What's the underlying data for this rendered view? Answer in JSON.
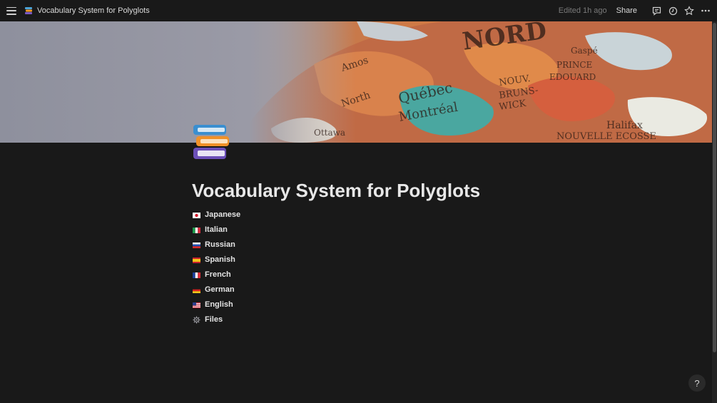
{
  "topbar": {
    "menu_icon": "hamburger-icon",
    "breadcrumb_emoji": "books-emoji",
    "breadcrumb_title": "Vocabulary System for Polyglots",
    "edited": "Edited 1h ago",
    "share_label": "Share",
    "icons": [
      "comment-icon",
      "clock-icon",
      "star-icon",
      "more-icon"
    ]
  },
  "cover": {
    "description_icon": "world-map-globe-image"
  },
  "page": {
    "icon": "books-emoji",
    "title": "Vocabulary System for Polyglots",
    "items": [
      {
        "label": "Japanese",
        "icon": "japan-flag-icon"
      },
      {
        "label": "Italian",
        "icon": "italy-flag-icon"
      },
      {
        "label": "Russian",
        "icon": "russia-flag-icon"
      },
      {
        "label": "Spanish",
        "icon": "spain-flag-icon"
      },
      {
        "label": "French",
        "icon": "france-flag-icon"
      },
      {
        "label": "German",
        "icon": "germany-flag-icon"
      },
      {
        "label": "English",
        "icon": "us-flag-icon"
      },
      {
        "label": "Files",
        "icon": "gear-icon"
      }
    ]
  },
  "help": {
    "label": "?"
  },
  "colors": {
    "background": "#191919",
    "text": "#e6e6e6",
    "muted": "#7a7a7a"
  }
}
